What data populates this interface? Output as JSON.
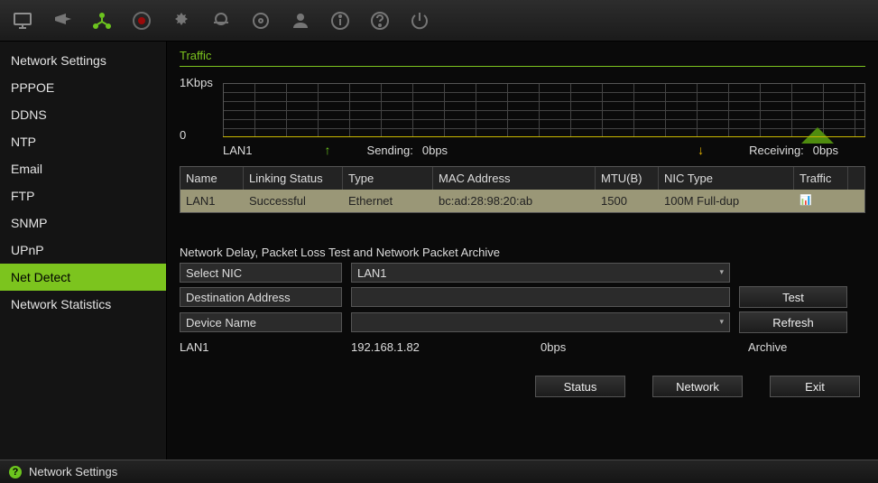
{
  "topbar": {
    "icons": [
      {
        "name": "monitor-icon"
      },
      {
        "name": "camera-icon"
      },
      {
        "name": "network-icon",
        "active": true
      },
      {
        "name": "record-icon"
      },
      {
        "name": "alarm-icon"
      },
      {
        "name": "search-icon"
      },
      {
        "name": "storage-icon"
      },
      {
        "name": "user-icon"
      },
      {
        "name": "info-icon"
      },
      {
        "name": "help-icon"
      },
      {
        "name": "power-icon"
      }
    ]
  },
  "sidebar": {
    "items": [
      {
        "label": "Network Settings"
      },
      {
        "label": "PPPOE"
      },
      {
        "label": "DDNS"
      },
      {
        "label": "NTP"
      },
      {
        "label": "Email"
      },
      {
        "label": "FTP"
      },
      {
        "label": "SNMP"
      },
      {
        "label": "UPnP"
      },
      {
        "label": "Net Detect",
        "active": true
      },
      {
        "label": "Network Statistics"
      }
    ]
  },
  "tabs": {
    "current": "Traffic"
  },
  "chart": {
    "y_top": "1Kbps",
    "y_bottom": "0",
    "interface": "LAN1",
    "sending_label": "Sending:",
    "sending_value": "0bps",
    "receiving_label": "Receiving:",
    "receiving_value": "0bps"
  },
  "table": {
    "headers": [
      "Name",
      "Linking Status",
      "Type",
      "MAC Address",
      "MTU(B)",
      "NIC Type",
      "Traffic"
    ],
    "rows": [
      {
        "name": "LAN1",
        "status": "Successful",
        "type": "Ethernet",
        "mac": "bc:ad:28:98:20:ab",
        "mtu": "1500",
        "nic": "100M Full-dup",
        "traffic_icon": "chart-indicator"
      }
    ]
  },
  "section": {
    "title": "Network Delay, Packet Loss Test and Network Packet Archive"
  },
  "form": {
    "nic_label": "Select NIC",
    "nic_value": "LAN1",
    "dest_label": "Destination Address",
    "dest_value": "",
    "device_label": "Device Name",
    "device_value": "",
    "test_btn": "Test",
    "refresh_btn": "Refresh",
    "archive_btn": "Archive",
    "info_nic": "LAN1",
    "info_ip": "192.168.1.82",
    "info_rate": "0bps"
  },
  "bottom_buttons": {
    "status": "Status",
    "network": "Network",
    "exit": "Exit"
  },
  "statusbar": {
    "context": "Network Settings"
  },
  "chart_data": {
    "type": "line",
    "title": "Traffic",
    "x": [
      0,
      1,
      2,
      3,
      4,
      5,
      6,
      7,
      8,
      9,
      10,
      11,
      12,
      13,
      14,
      15,
      16,
      17,
      18,
      19,
      20
    ],
    "series": [
      {
        "name": "Sending",
        "values": [
          0,
          0,
          0,
          0,
          0,
          0,
          0,
          0,
          0,
          0,
          0,
          0,
          0,
          0,
          0,
          0,
          0,
          0,
          0,
          0,
          0
        ]
      },
      {
        "name": "Receiving",
        "values": [
          0,
          0,
          0,
          0,
          0,
          0,
          0,
          0,
          0,
          0,
          0,
          0,
          0,
          0,
          0,
          0,
          0,
          300,
          0,
          0,
          0
        ]
      }
    ],
    "ylabel": "bps",
    "ylim": [
      0,
      1000
    ],
    "xlabel": "",
    "legend_position": "bottom"
  }
}
